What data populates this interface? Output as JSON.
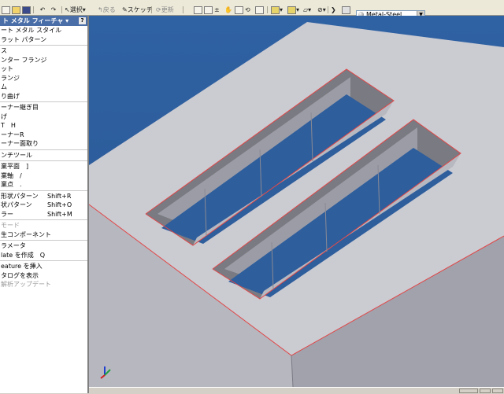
{
  "toolbar": {
    "select_label": "選択",
    "return_label": "戻る",
    "sketch_label": "スケッチ",
    "properties_label": "更新",
    "material": "Metal-Steel"
  },
  "panel": {
    "title": "ト メタル フィーチャ ▾",
    "help": "?",
    "items": [
      {
        "label": "ート メタル スタイル",
        "shortcut": "",
        "enabled": true
      },
      {
        "label": "ラット パターン",
        "shortcut": "",
        "enabled": true
      },
      {
        "sep": true
      },
      {
        "label": "ス",
        "shortcut": "",
        "enabled": true
      },
      {
        "label": "ンター フランジ",
        "shortcut": "",
        "enabled": true
      },
      {
        "label": "ット",
        "shortcut": "",
        "enabled": true
      },
      {
        "label": "ランジ",
        "shortcut": "",
        "enabled": true
      },
      {
        "label": "ム",
        "shortcut": "",
        "enabled": true
      },
      {
        "label": "り曲げ",
        "shortcut": "",
        "enabled": true
      },
      {
        "sep": true
      },
      {
        "label": "ーナー継ぎ目",
        "shortcut": "",
        "enabled": true
      },
      {
        "label": "げ",
        "shortcut": "",
        "enabled": true
      },
      {
        "label": "T　H",
        "shortcut": "",
        "enabled": true
      },
      {
        "label": "ーナーR",
        "shortcut": "",
        "enabled": true
      },
      {
        "label": "ーナー面取り",
        "shortcut": "",
        "enabled": true
      },
      {
        "sep": true
      },
      {
        "label": "ンチツール",
        "shortcut": "",
        "enabled": true
      },
      {
        "sep": true
      },
      {
        "label": "業平面　]",
        "shortcut": "",
        "enabled": true
      },
      {
        "label": "業軸　/",
        "shortcut": "",
        "enabled": true
      },
      {
        "label": "業点　.",
        "shortcut": "",
        "enabled": true
      },
      {
        "sep": true
      },
      {
        "label": "形状パターン",
        "shortcut": "Shift+R",
        "enabled": true
      },
      {
        "label": "状パターン",
        "shortcut": "Shift+O",
        "enabled": true
      },
      {
        "label": "ラー",
        "shortcut": "Shift+M",
        "enabled": true
      },
      {
        "sep": true
      },
      {
        "label": "モード",
        "shortcut": "",
        "enabled": false
      },
      {
        "label": "生コンポーネント",
        "shortcut": "",
        "enabled": true
      },
      {
        "sep": true
      },
      {
        "label": "ラメータ",
        "shortcut": "",
        "enabled": true
      },
      {
        "label": "late を作成　Q",
        "shortcut": "",
        "enabled": true
      },
      {
        "sep": true
      },
      {
        "label": "eature を挿入",
        "shortcut": "",
        "enabled": true
      },
      {
        "label": "タログを表示",
        "shortcut": "",
        "enabled": true
      },
      {
        "label": "解析アップデート",
        "shortcut": "",
        "enabled": false
      }
    ]
  },
  "colors": {
    "viewport_bg": "#2e5e9c",
    "part_top": "#c9c9d0",
    "part_front": "#b4b4bc",
    "part_side": "#9c9ca6",
    "edge_highlight": "#e04848"
  }
}
